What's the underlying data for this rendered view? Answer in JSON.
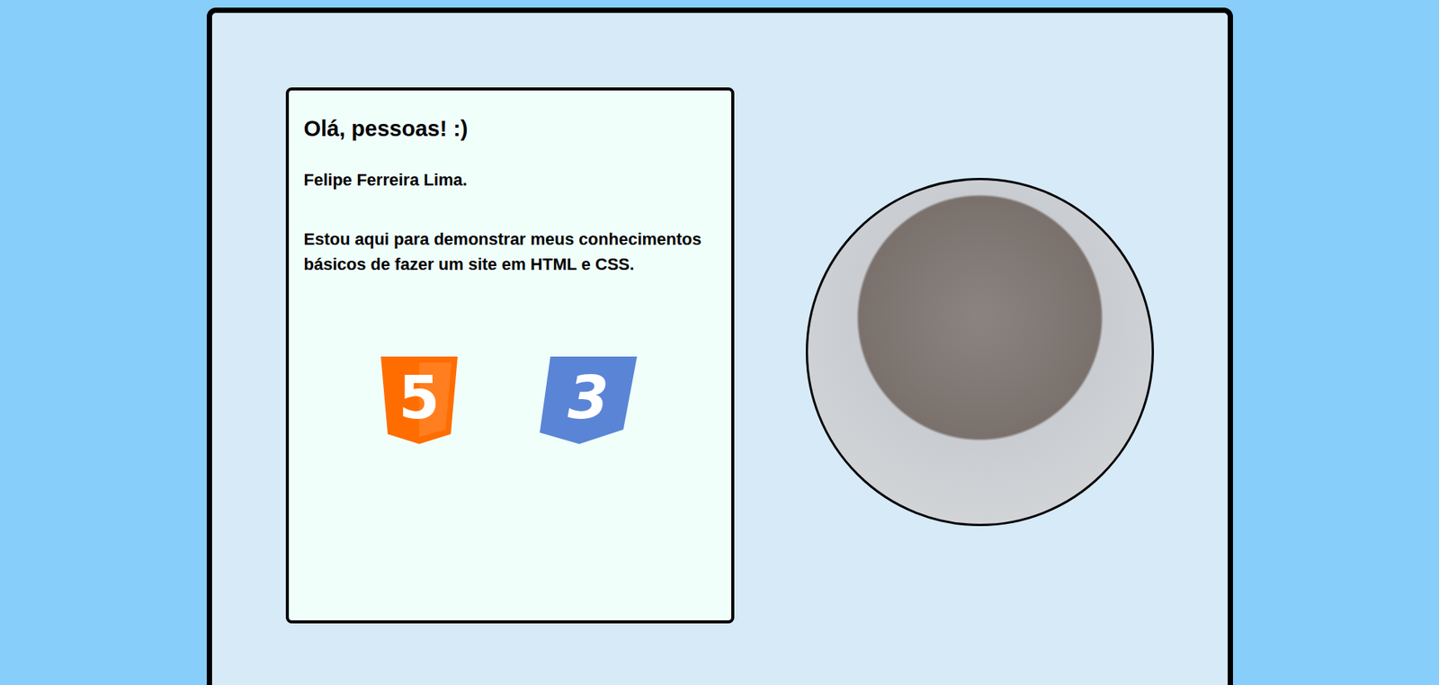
{
  "greeting": "Olá, pessoas! :)",
  "name": "Felipe Ferreira Lima.",
  "description": "Estou aqui para demonstrar meus conhecimentos básicos de fazer um site em HTML e CSS.",
  "logos": [
    {
      "glyph": "5",
      "color": "#ff6d00"
    },
    {
      "glyph": "3",
      "color": "#5a85d6"
    }
  ]
}
